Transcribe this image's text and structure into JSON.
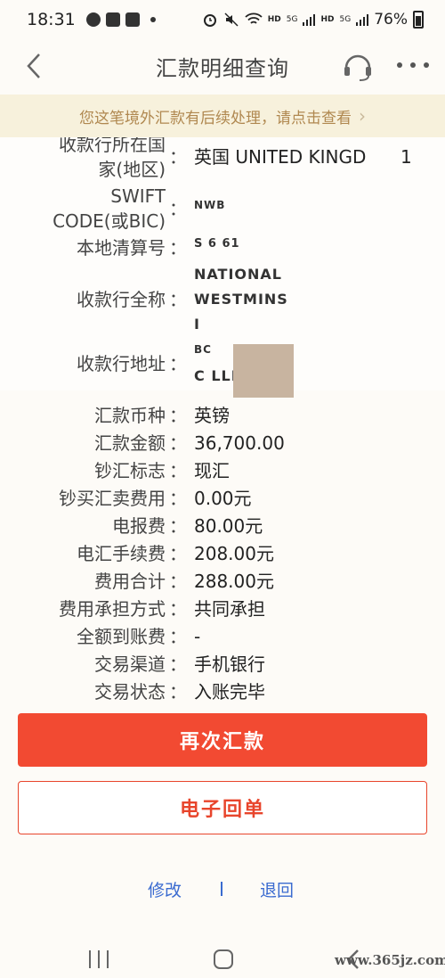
{
  "status_bar": {
    "time": "18:31",
    "battery": "76%",
    "hd1": "HD",
    "hd2": "HD",
    "sig1": "5G",
    "sig2": "5G"
  },
  "header": {
    "title": "汇款明细查询"
  },
  "notice": {
    "text": "您这笔境外汇款有后续处理，请点击查看",
    "chevron": "›"
  },
  "details_top": [
    {
      "label": "收款行所在国",
      "label2": "家(地区)",
      "value": "英国 UNITED KINGD",
      "value2": "1"
    },
    {
      "label": "SWIFT",
      "label2": "CODE(或BIC)",
      "value": "NWB"
    },
    {
      "label": "本地清算号",
      "value": "S 6 61"
    },
    {
      "label": "收款行全称",
      "value": "NATIONAL",
      "value2": "WESTMINS",
      "value3": "I"
    },
    {
      "label": "收款行地址",
      "value": "BC",
      "value2": "C LLEPE"
    }
  ],
  "details_bottom": [
    {
      "label": "汇款币种",
      "value": "英镑"
    },
    {
      "label": "汇款金额",
      "value": "36,700.00"
    },
    {
      "label": "钞汇标志",
      "value": "现汇"
    },
    {
      "label": "钞买汇卖费用",
      "value": "0.00元"
    },
    {
      "label": "电报费",
      "value": "80.00元"
    },
    {
      "label": "电汇手续费",
      "value": "208.00元"
    },
    {
      "label": "费用合计",
      "value": "288.00元"
    },
    {
      "label": "费用承担方式",
      "value": "共同承担"
    },
    {
      "label": "全额到账费",
      "value": "-"
    },
    {
      "label": "交易渠道",
      "value": "手机银行"
    },
    {
      "label": "交易状态",
      "value": "入账完毕"
    }
  ],
  "colon": "：",
  "buttons": {
    "remit_again": "再次汇款",
    "e_receipt": "电子回单"
  },
  "links": {
    "modify": "修改",
    "back": "退回"
  },
  "watermark": "www.365jz.com",
  "colors": {
    "primary": "#f24a32",
    "link": "#3a6bd0",
    "notice_text": "#b08850",
    "notice_bg": "#f7f1dc"
  }
}
